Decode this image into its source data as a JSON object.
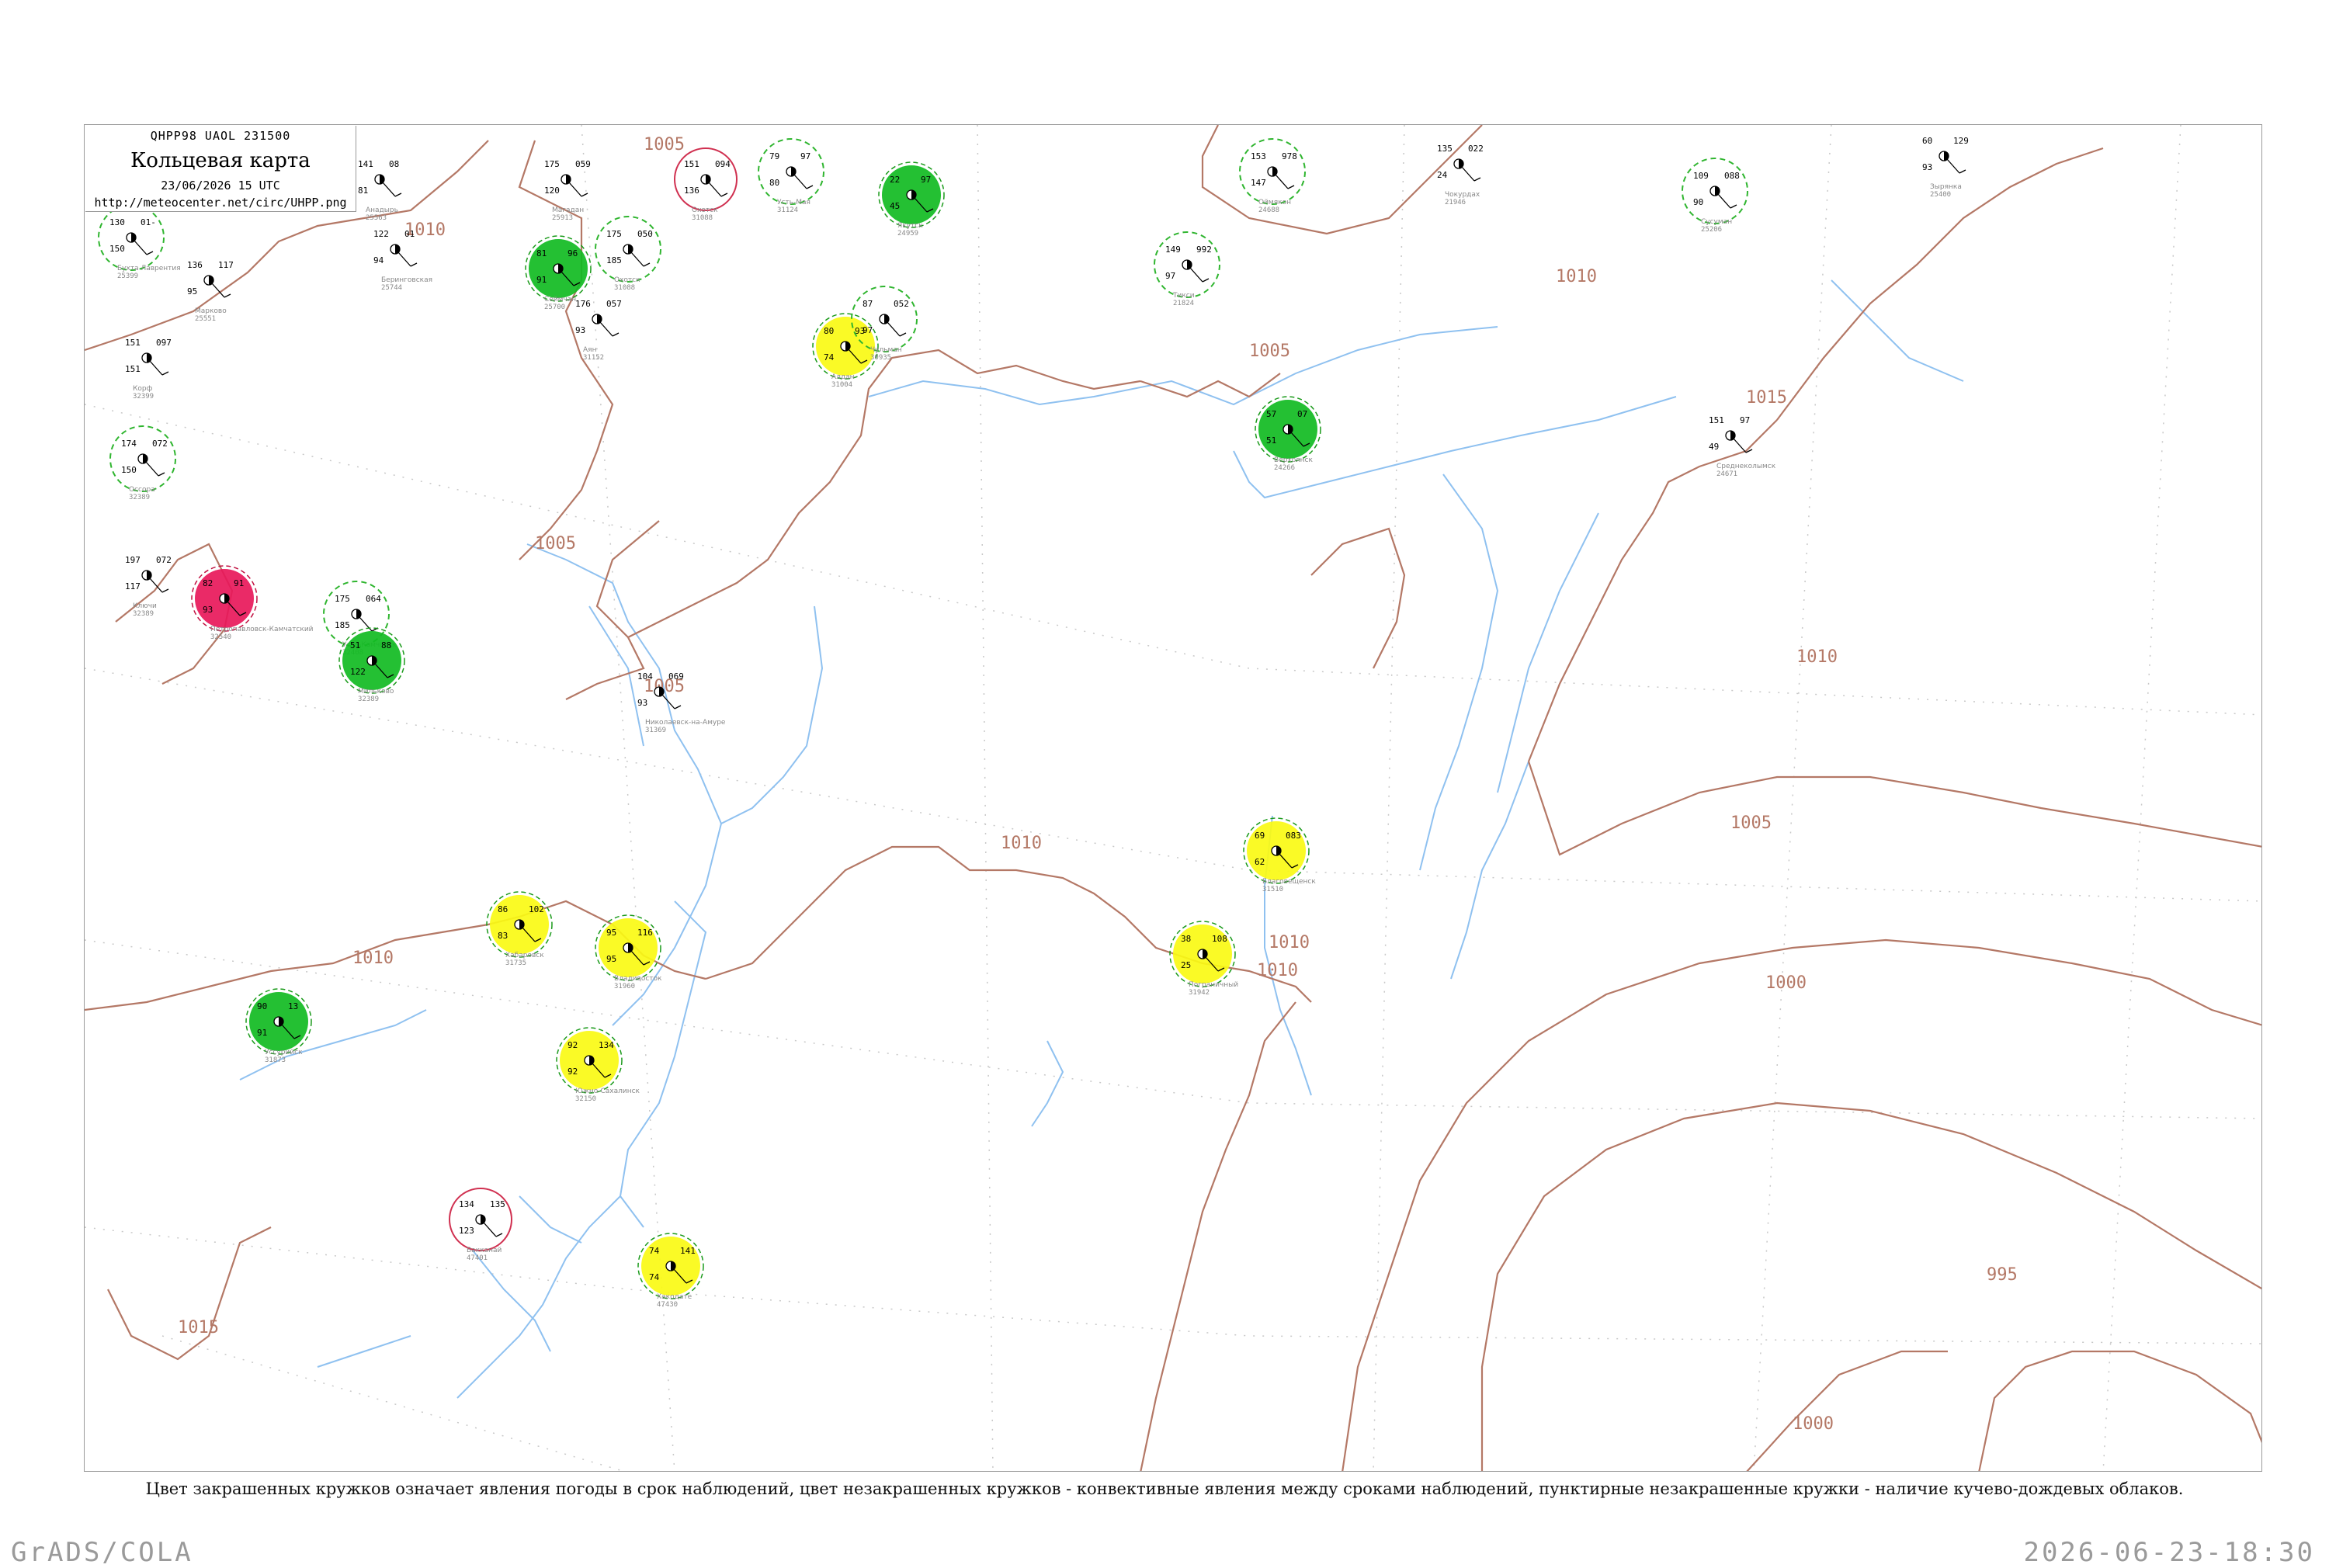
{
  "legend": {
    "code": "QHPP98  UAOL  231500",
    "title": "Кольцевая карта",
    "time": "23/06/2026 15 UTC",
    "url": "http://meteocenter.net/circ/UHPP.png"
  },
  "caption": "Цвет закрашенных кружков означает явления погоды в срок наблюдений, цвет незакрашенных кружков - конвективные явления между сроками наблюдений, пунктирные незакрашенные кружки - наличие кучево-дождевых облаков.",
  "footer": {
    "left": "GrADS/COLA",
    "right": "2026-06-23-18:30"
  },
  "colors": {
    "isobar": "#b47866",
    "coast": "#8fc1f0",
    "thunder": "#11bb22",
    "rain": "#fafa14",
    "heavy": "#e8185a",
    "cb_ring": "#2fb52f",
    "grid": "#bfbfbf"
  },
  "isobars": [
    {
      "label": "1010"
    },
    {
      "label": "1005"
    },
    {
      "label": "1005"
    },
    {
      "label": "1005"
    },
    {
      "label": "1005"
    },
    {
      "label": "1010"
    },
    {
      "label": "1010"
    },
    {
      "label": "1015"
    },
    {
      "label": "1010"
    },
    {
      "label": "1010"
    },
    {
      "label": "1010"
    },
    {
      "label": "1010"
    },
    {
      "label": "1005"
    },
    {
      "label": "1000"
    },
    {
      "label": "1015"
    },
    {
      "label": "995"
    },
    {
      "label": "1000"
    }
  ],
  "stations": [
    {
      "name": "Бухта Лаврентия",
      "id": "25399",
      "data": [
        "130",
        "01-",
        "150"
      ],
      "type": "cb"
    },
    {
      "name": "Анадырь",
      "id": "25563",
      "data": [
        "141",
        "08",
        "81"
      ],
      "type": "none"
    },
    {
      "name": "Беринговская",
      "id": "25744",
      "data": [
        "122",
        "01",
        "94"
      ],
      "type": "none"
    },
    {
      "name": "Марково",
      "id": "25551",
      "data": [
        "136",
        "117",
        "95"
      ],
      "type": "none"
    },
    {
      "name": "Корф",
      "id": "32399",
      "data": [
        "151",
        "097",
        "151"
      ],
      "type": "none"
    },
    {
      "name": "Оссора",
      "id": "32389",
      "data": [
        "174",
        "072",
        "150"
      ],
      "type": "cb"
    },
    {
      "name": "Ключи",
      "id": "32389",
      "data": [
        "197",
        "072",
        "117"
      ],
      "type": "none"
    },
    {
      "name": "Петропавловск-Камчатский",
      "id": "32540",
      "data": [
        "82",
        "91",
        "93"
      ],
      "type": "heavy"
    },
    {
      "name": "Усть-Камчатск",
      "id": "32408",
      "data": [
        "175",
        "064",
        "185"
      ],
      "type": "cb"
    },
    {
      "name": "Мильково",
      "id": "32389",
      "data": [
        "51",
        "88",
        "122"
      ],
      "type": "thunder"
    },
    {
      "name": "Магадан",
      "id": "25913",
      "data": [
        "175",
        "059",
        "120"
      ],
      "type": "none"
    },
    {
      "name": "Сеймчан",
      "id": "25700",
      "data": [
        "81",
        "96",
        "91"
      ],
      "type": "thunder"
    },
    {
      "name": "Охотск",
      "id": "31088",
      "data": [
        "175",
        "050",
        "185"
      ],
      "type": "cb"
    },
    {
      "name": "Аян",
      "id": "31152",
      "data": [
        "176",
        "057",
        "93"
      ],
      "type": "none"
    },
    {
      "name": "Николаевск-на-Амуре",
      "id": "31369",
      "data": [
        "104",
        "069",
        "93"
      ],
      "type": "none"
    },
    {
      "name": "Охотск",
      "id": "31088",
      "data": [
        "151",
        "094",
        "136"
      ],
      "type": "outline_red"
    },
    {
      "name": "Усть-Мая",
      "id": "31124",
      "data": [
        "79",
        "97",
        "80"
      ],
      "type": "cb"
    },
    {
      "name": "Якутск",
      "id": "24959",
      "data": [
        "22",
        "97",
        "45"
      ],
      "type": "thunder"
    },
    {
      "name": "Алдан",
      "id": "31004",
      "data": [
        "80",
        "93",
        "74"
      ],
      "type": "rain"
    },
    {
      "name": "Чульман",
      "id": "30935",
      "data": [
        "87",
        "052",
        "97"
      ],
      "type": "cb"
    },
    {
      "name": "Оймякон",
      "id": "24688",
      "data": [
        "153",
        "978",
        "147"
      ],
      "type": "cb"
    },
    {
      "name": "Тикси",
      "id": "21824",
      "data": [
        "149",
        "992",
        "97"
      ],
      "type": "cb"
    },
    {
      "name": "Верхоянск",
      "id": "24266",
      "data": [
        "57",
        "07",
        "51"
      ],
      "type": "thunder"
    },
    {
      "name": "Чокурдах",
      "id": "21946",
      "data": [
        "135",
        "022",
        "24"
      ],
      "type": "none"
    },
    {
      "name": "Сусуман",
      "id": "25206",
      "data": [
        "109",
        "088",
        "90"
      ],
      "type": "cb"
    },
    {
      "name": "Зырянка",
      "id": "25400",
      "data": [
        "60",
        "129",
        "93"
      ],
      "type": "none"
    },
    {
      "name": "Среднеколымск",
      "id": "24671",
      "data": [
        "151",
        "97",
        "49"
      ],
      "type": "none"
    },
    {
      "name": "Благовещенск",
      "id": "31510",
      "data": [
        "69",
        "083",
        "62"
      ],
      "type": "rain"
    },
    {
      "name": "Хабаровск",
      "id": "31735",
      "data": [
        "86",
        "102",
        "83"
      ],
      "type": "rain"
    },
    {
      "name": "Владивосток",
      "id": "31960",
      "data": [
        "95",
        "116",
        "95"
      ],
      "type": "rain"
    },
    {
      "name": "Южно-Сахалинск",
      "id": "32150",
      "data": [
        "92",
        "134",
        "92"
      ],
      "type": "rain"
    },
    {
      "name": "Уссурийск",
      "id": "31873",
      "data": [
        "90",
        "13",
        "91"
      ],
      "type": "thunder"
    },
    {
      "name": "Пограничный",
      "id": "31942",
      "data": [
        "38",
        "108",
        "25"
      ],
      "type": "rain"
    },
    {
      "name": "Хакодате",
      "id": "47430",
      "data": [
        "74",
        "141",
        "74"
      ],
      "type": "rain"
    },
    {
      "name": "Вакканай",
      "id": "47401",
      "data": [
        "134",
        "135",
        "123"
      ],
      "type": "outline_red"
    }
  ]
}
